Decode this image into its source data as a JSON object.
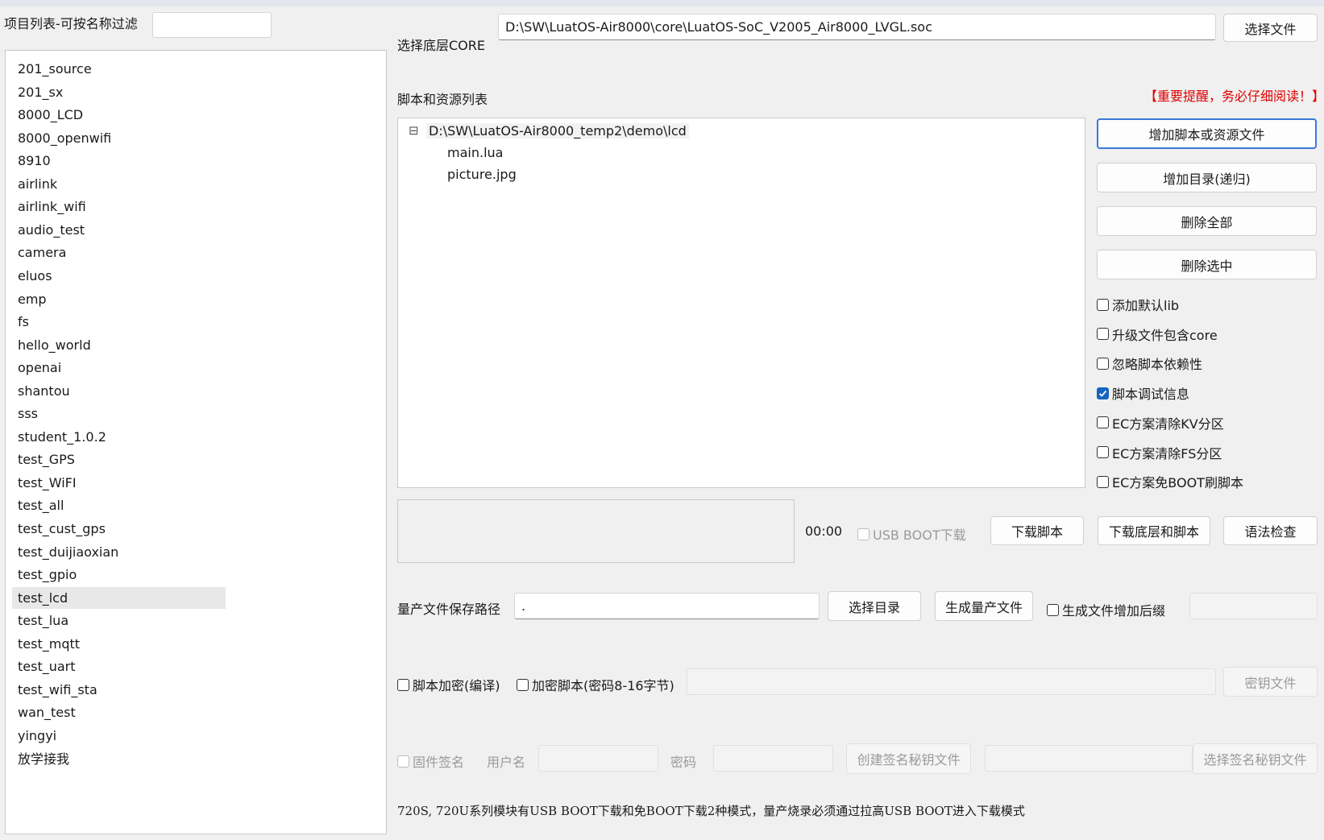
{
  "project_panel": {
    "filter_label": "项目列表-可按名称过滤",
    "filter_value": "",
    "items": [
      "201_source",
      "201_sx",
      "8000_LCD",
      "8000_openwifi",
      "8910",
      "airlink",
      "airlink_wifi",
      "audio_test",
      "camera",
      "eluos",
      "emp",
      "fs",
      "hello_world",
      "openai",
      "shantou",
      "sss",
      "student_1.0.2",
      "test_GPS",
      "test_WiFI",
      "test_all",
      "test_cust_gps",
      "test_duijiaoxian",
      "test_gpio",
      "test_lcd",
      "test_lua",
      "test_mqtt",
      "test_uart",
      "test_wifi_sta",
      "wan_test",
      "yingyi",
      "放学接我"
    ],
    "selected": "test_lcd"
  },
  "core": {
    "label": "选择底层CORE",
    "path": "D:\\SW\\LuatOS-Air8000\\core\\LuatOS-SoC_V2005_Air8000_LVGL.soc",
    "choose_button": "选择文件"
  },
  "scripts": {
    "label": "脚本和资源列表",
    "warning": "【重要提醒，务必仔细阅读！】",
    "tree": {
      "root": "D:\\SW\\LuatOS-Air8000_temp2\\demo\\lcd",
      "collapse_glyph": "⊟",
      "children": [
        "main.lua",
        "picture.jpg"
      ]
    },
    "buttons": {
      "add_file": "增加脚本或资源文件",
      "add_dir": "增加目录(递归)",
      "delete_all": "删除全部",
      "delete_selected": "删除选中"
    },
    "options": [
      {
        "label": "添加默认lib",
        "checked": false
      },
      {
        "label": "升级文件包含core",
        "checked": false
      },
      {
        "label": "忽略脚本依赖性",
        "checked": false
      },
      {
        "label": "脚本调试信息",
        "checked": true
      },
      {
        "label": "EC方案清除KV分区",
        "checked": false
      },
      {
        "label": "EC方案清除FS分区",
        "checked": false
      },
      {
        "label": "EC方案免BOOT刷脚本",
        "checked": false
      }
    ]
  },
  "download": {
    "timer": "00:00",
    "usb_boot_label": "USB BOOT下载",
    "download_script": "下载脚本",
    "download_core_script": "下载底层和脚本",
    "syntax_check": "语法检查"
  },
  "mass": {
    "label": "量产文件保存路径",
    "path": ".",
    "choose_dir": "选择目录",
    "generate": "生成量产文件",
    "suffix_label": "生成文件增加后缀",
    "suffix_value": ""
  },
  "encrypt": {
    "compile_label": "脚本加密(编译)",
    "password_label": "加密脚本(密码8-16字节)",
    "password_value": "",
    "key_file": "密钥文件"
  },
  "sign": {
    "firmware_sign": "固件签名",
    "username_label": "用户名",
    "password_label": "密码",
    "create_key": "创建签名秘钥文件",
    "choose_key": "选择签名秘钥文件"
  },
  "footer_note": "720S, 720U系列模块有USB BOOT下载和免BOOT下载2种模式，量产烧录必须通过拉高USB BOOT进入下载模式"
}
